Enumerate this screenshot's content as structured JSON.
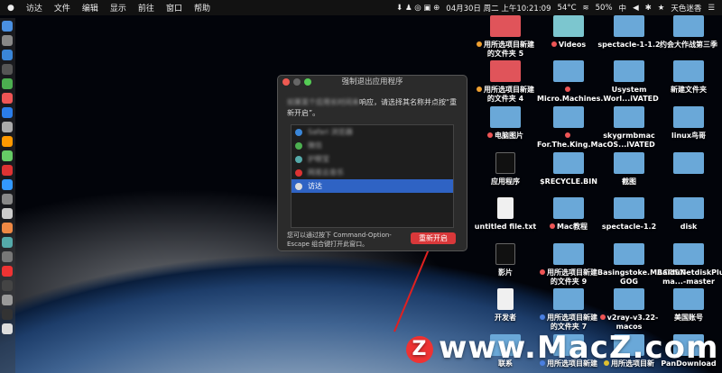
{
  "menubar": {
    "apple": "",
    "items": [
      "访达",
      "文件",
      "编辑",
      "显示",
      "前往",
      "窗口",
      "帮助"
    ],
    "datetime": "04月30日 周二 上午10:21:09",
    "temp": "54°C",
    "battery": "50%",
    "input": "中",
    "user": "天色迷香"
  },
  "dialog": {
    "title": "强制退出应用程序",
    "message_blur": "如果某个应用长时间未",
    "message": "响应，请选择其名称并点按“重新开启”。",
    "apps": [
      {
        "name": "Safari 浏览器",
        "color": "#3a86d8"
      },
      {
        "name": "微信",
        "color": "#4caf50"
      },
      {
        "name": "护眼宝",
        "color": "#5aa"
      },
      {
        "name": "网易云音乐",
        "color": "#d33"
      },
      {
        "name": "访达",
        "color": "#ddd"
      }
    ],
    "selected": "访达",
    "footer": "您可以通过按下 Command-Option-Escape 组合键打开此窗口。",
    "button": "重新开启"
  },
  "desktop": [
    {
      "label": "用所选项目新建的文件夹 5",
      "type": "red",
      "tag": "#f0a030"
    },
    {
      "label": "Videos",
      "type": "teal",
      "tag": "#e55"
    },
    {
      "label": "spectacle-1-1.2",
      "type": ""
    },
    {
      "label": "约会大作战第三季",
      "type": ""
    },
    {
      "label": "用所选项目新建的文件夹 4",
      "type": "red",
      "tag": "#f0a030"
    },
    {
      "label": "Micro.Machines.Worl...iVATED",
      "type": "",
      "tag": "#e55"
    },
    {
      "label": "Usystem",
      "type": ""
    },
    {
      "label": "新建文件夹",
      "type": ""
    },
    {
      "label": "电脑图片",
      "type": "",
      "tag": "#e55"
    },
    {
      "label": "For.The.King.MacOS...iVATED",
      "type": "",
      "tag": "#e55"
    },
    {
      "label": "skygrmbmac",
      "type": ""
    },
    {
      "label": "linux鸟哥",
      "type": ""
    },
    {
      "label": "应用程序",
      "type": "term"
    },
    {
      "label": "$RECYCLE.BIN",
      "type": ""
    },
    {
      "label": "截图",
      "type": ""
    },
    {
      "label": "",
      "type": ""
    },
    {
      "label": "untitled file.txt",
      "type": "doc"
    },
    {
      "label": "Mac教程",
      "type": "",
      "tag": "#e55"
    },
    {
      "label": "spectacle-1.2",
      "type": ""
    },
    {
      "label": "disk",
      "type": ""
    },
    {
      "label": "影片",
      "type": "term"
    },
    {
      "label": "用所选项目新建的文件夹 9",
      "type": "",
      "tag": "#e55"
    },
    {
      "label": "Basingstoke.MACOSX-GOG",
      "type": ""
    },
    {
      "label": "BaiduNetdiskPlugin-ma...-master",
      "type": ""
    },
    {
      "label": "开发者",
      "type": "doc"
    },
    {
      "label": "用所选项目新建的文件夹 7",
      "type": "",
      "tag": "#4a7fe0"
    },
    {
      "label": "v2ray-v3.22-macos",
      "type": "",
      "tag": "#e55"
    },
    {
      "label": "美国账号",
      "type": ""
    },
    {
      "label": "联系",
      "type": ""
    },
    {
      "label": "用所选项目新建",
      "type": "",
      "tag": "#4a7fe0"
    },
    {
      "label": "用所选项目新",
      "type": "",
      "tag": "#e0c030"
    },
    {
      "label": "PanDownload",
      "type": ""
    }
  ],
  "watermark": {
    "logo": "Z",
    "text": "www.MacZ.com"
  }
}
